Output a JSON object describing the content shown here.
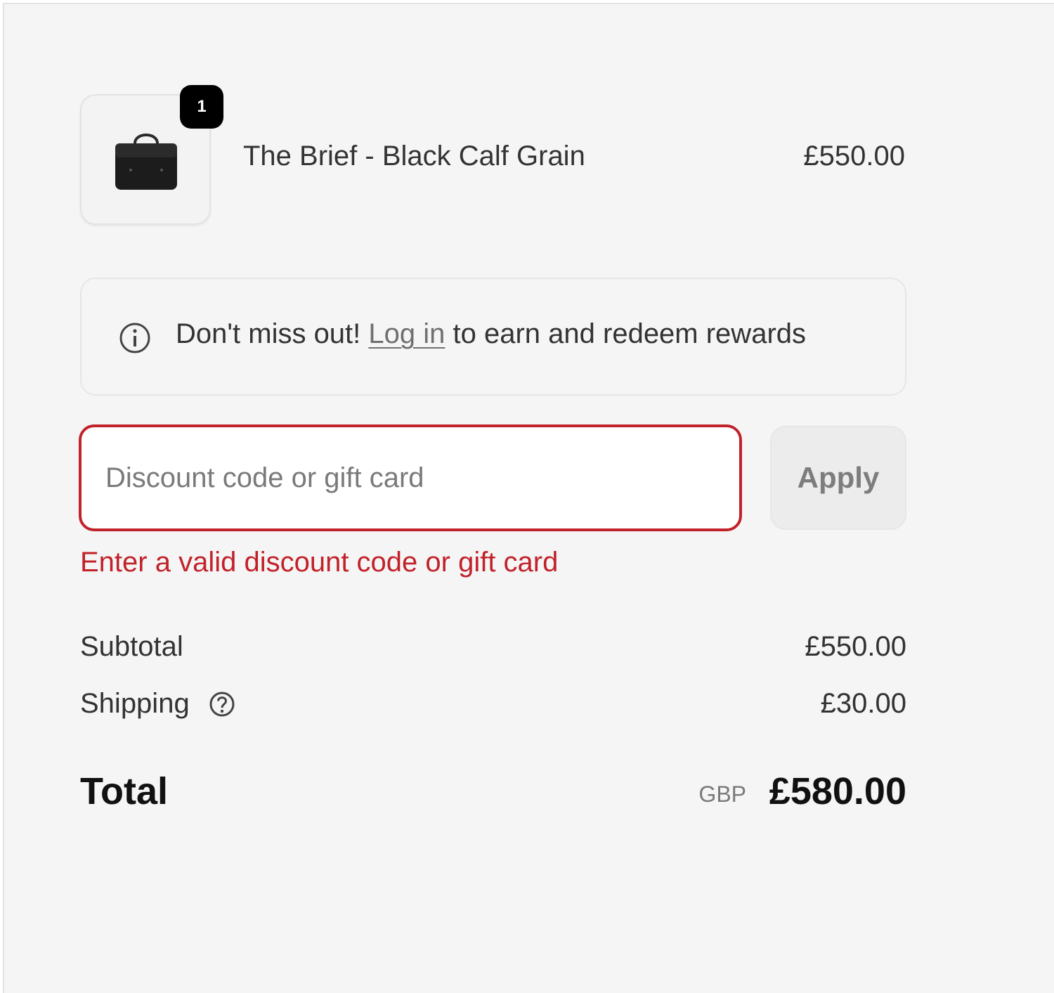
{
  "line_item": {
    "quantity": "1",
    "name": "The Brief - Black Calf Grain",
    "price": "£550.00",
    "image_icon": "briefcase-icon"
  },
  "rewards_notice": {
    "icon": "info-icon",
    "text_before": "Don't miss out! ",
    "link_text": "Log in",
    "text_after": " to earn and redeem rewards"
  },
  "discount": {
    "placeholder": "Discount code or gift card",
    "value": "",
    "apply_label": "Apply",
    "error_message": "Enter a valid discount code or gift card",
    "error_color": "#c1222a"
  },
  "summary": {
    "subtotal_label": "Subtotal",
    "subtotal_value": "£550.00",
    "shipping_label": "Shipping",
    "shipping_help_icon": "question-circle-icon",
    "shipping_value": "£30.00",
    "total_label": "Total",
    "total_currency": "GBP",
    "total_value": "£580.00"
  }
}
